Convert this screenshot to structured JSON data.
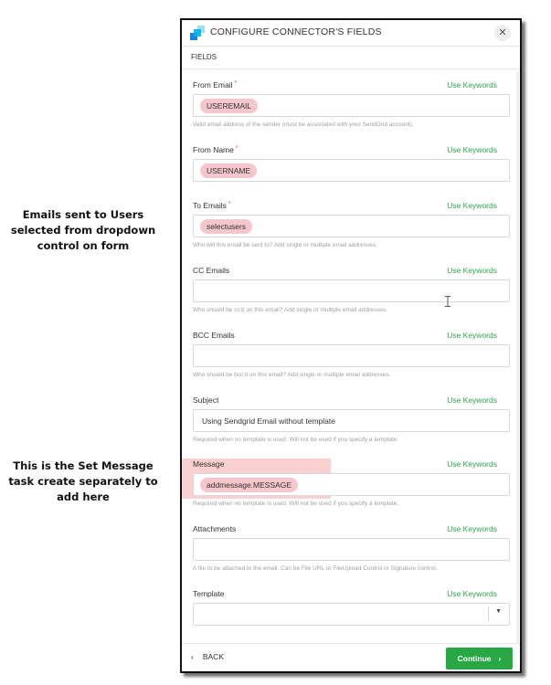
{
  "annotations": {
    "first": "Emails sent to Users selected from dropdown control on form",
    "second": "This is the Set Message task create separately to add here"
  },
  "panel": {
    "title": "CONFIGURE CONNECTOR'S FIELDS",
    "close_glyph": "✕",
    "section_label": "FIELDS"
  },
  "use_keywords_label": "Use Keywords",
  "required_mark": "*",
  "fields": {
    "from_email": {
      "label": "From Email",
      "tag": "USEREMAIL",
      "help": "Valid email address of the sender (must be associated with your SendGrid account)."
    },
    "from_name": {
      "label": "From Name",
      "tag": "USERNAME"
    },
    "to_emails": {
      "label": "To Emails",
      "tag": "selectusers",
      "help": "Who will this email be sent to? Add single or multiple email addresses."
    },
    "cc_emails": {
      "label": "CC Emails",
      "help": "Who should be cc'd on this email? Add single or multiple email addresses."
    },
    "bcc_emails": {
      "label": "BCC Emails",
      "help": "Who should be bcc'd on this email? Add single or multiple email addresses."
    },
    "subject": {
      "label": "Subject",
      "value": "Using Sendgrid Email without template",
      "help": "Required when no template is used. Will not be used if you specify a template."
    },
    "message": {
      "label": "Message",
      "tag": "addmessage.MESSAGE",
      "help": "Required when no template is used. Will not be used if you specify a template."
    },
    "attachments": {
      "label": "Attachments",
      "help": "A file to be attached to the email. Can be File URL or FileUpload Control or Signature control."
    },
    "template": {
      "label": "Template",
      "caret": "▼"
    }
  },
  "footer": {
    "back_chevron": "‹",
    "back_label": "BACK",
    "continue_label": "Continue",
    "continue_chevron": "›"
  },
  "colors": {
    "accent_green": "#28a745",
    "tag_pink": "#f5c6cb",
    "highlight_pink": "#f8aaaa",
    "required_red": "#d9534f"
  },
  "icons": {
    "logo": "sendgrid-logo-icon",
    "close": "close-icon",
    "back": "chevron-left-icon",
    "continue": "chevron-right-icon",
    "dropdown": "caret-down-icon",
    "cursor": "text-cursor-icon"
  }
}
